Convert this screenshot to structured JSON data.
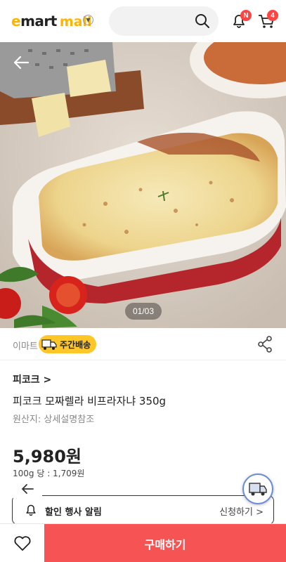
{
  "header": {
    "logo_e": "e",
    "logo_mart": "mart",
    "logo_mall": "mall",
    "notification_badge": "N",
    "cart_count": "4"
  },
  "gallery": {
    "pager": "01/03"
  },
  "seller": {
    "name": "이마트",
    "shipping_badge": "주간배송"
  },
  "product": {
    "brand": "피코크 >",
    "title": "피코크 모짜렐라 비프라자냐 350g",
    "origin": "원산지: 상세설명참조",
    "price": "5,980원",
    "unit_price": "100g 당 : 1,709원"
  },
  "alert": {
    "label": "할인 행사 알림",
    "apply": "신청하기 >"
  },
  "bottom_bar": {
    "buy_label": "구매하기"
  },
  "colors": {
    "brand_yellow": "#ffb400",
    "buy_red": "#f65454",
    "badge_red": "#ff4444"
  }
}
